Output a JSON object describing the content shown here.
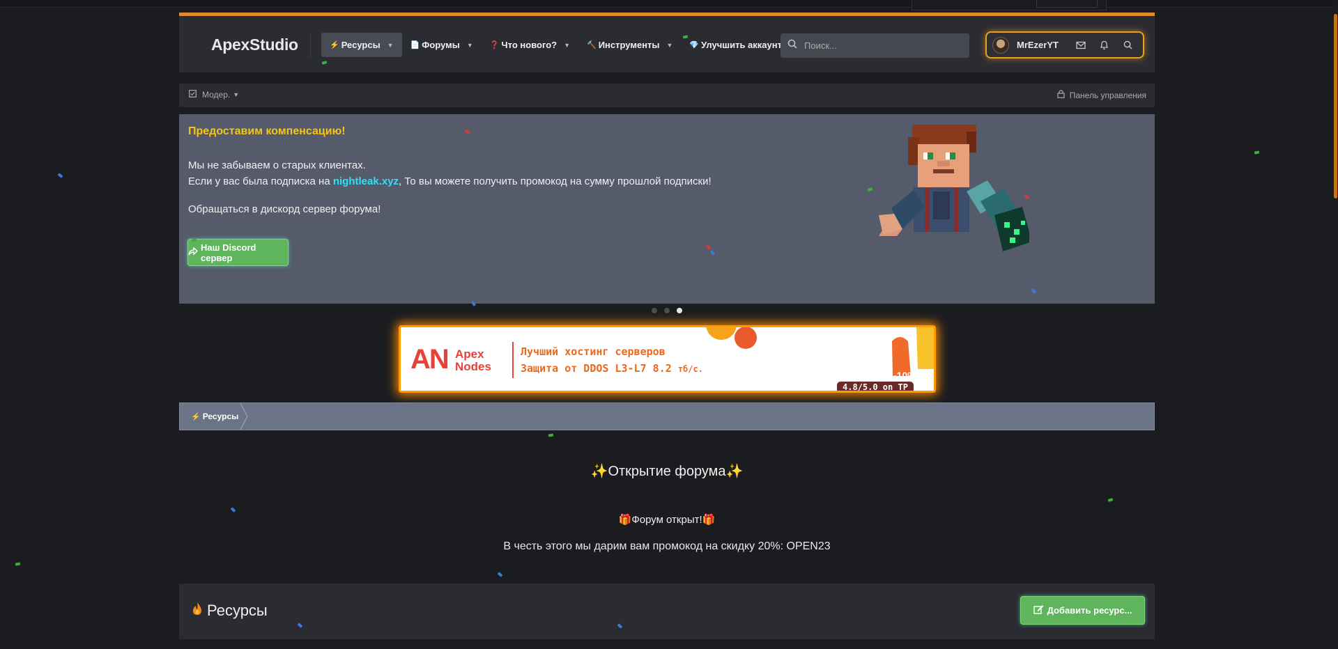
{
  "header": {
    "logo": "ApexStudio",
    "nav": [
      {
        "emoji": "⚡",
        "label": "Ресурсы"
      },
      {
        "emoji": "📄",
        "label": "Форумы"
      },
      {
        "emoji": "❓",
        "label": "Что нового?"
      },
      {
        "emoji": "🔨",
        "label": "Инструменты"
      },
      {
        "emoji": "💎",
        "label": "Улучшить аккаунт"
      }
    ],
    "search_placeholder": "Поиск...",
    "username": "MrEzerYT"
  },
  "subnav": {
    "mod_label": "Модер.",
    "panel_label": "Панель управления"
  },
  "slider": {
    "title": "Предоставим компенсацию!",
    "line1": "Мы не забываем о старых клиентах.",
    "line2_prefix": "Если у вас была подписка на ",
    "line2_link": "nightleak.xyz",
    "line2_suffix": ", То вы можете получить промокод на сумму прошлой подписки!",
    "line3": "Обращаться в дискорд сервер форума!",
    "button": "Наш Discord сервер",
    "active_dot": 3
  },
  "banner": {
    "logo_mark": "AN",
    "logo_line1": "Apex",
    "logo_line2": "Nodes",
    "line1": "Лучший хостинг серверов",
    "line2": "Защита от DDOS L3-L7 8.2",
    "line2_unit": "тб/с.",
    "discount": "-10%",
    "rating": "4.8/5.0 on TP"
  },
  "breadcrumb": {
    "emoji": "⚡",
    "label": "Ресурсы"
  },
  "announcement": {
    "title": "✨Открытие форума✨",
    "subtitle": "🎁Форум открыт!🎁",
    "promo": "В честь этого мы дарим вам промокод на скидку 20%: OPEN23"
  },
  "resources": {
    "title": "Ресурсы",
    "add_button": "Добавить ресурс..."
  },
  "colors": {
    "accent": "#e28a2d",
    "green_button": "#5fb55b",
    "slider_bg": "#555b6a",
    "link": "#2ee0f5",
    "title_yellow": "#f5c518"
  }
}
